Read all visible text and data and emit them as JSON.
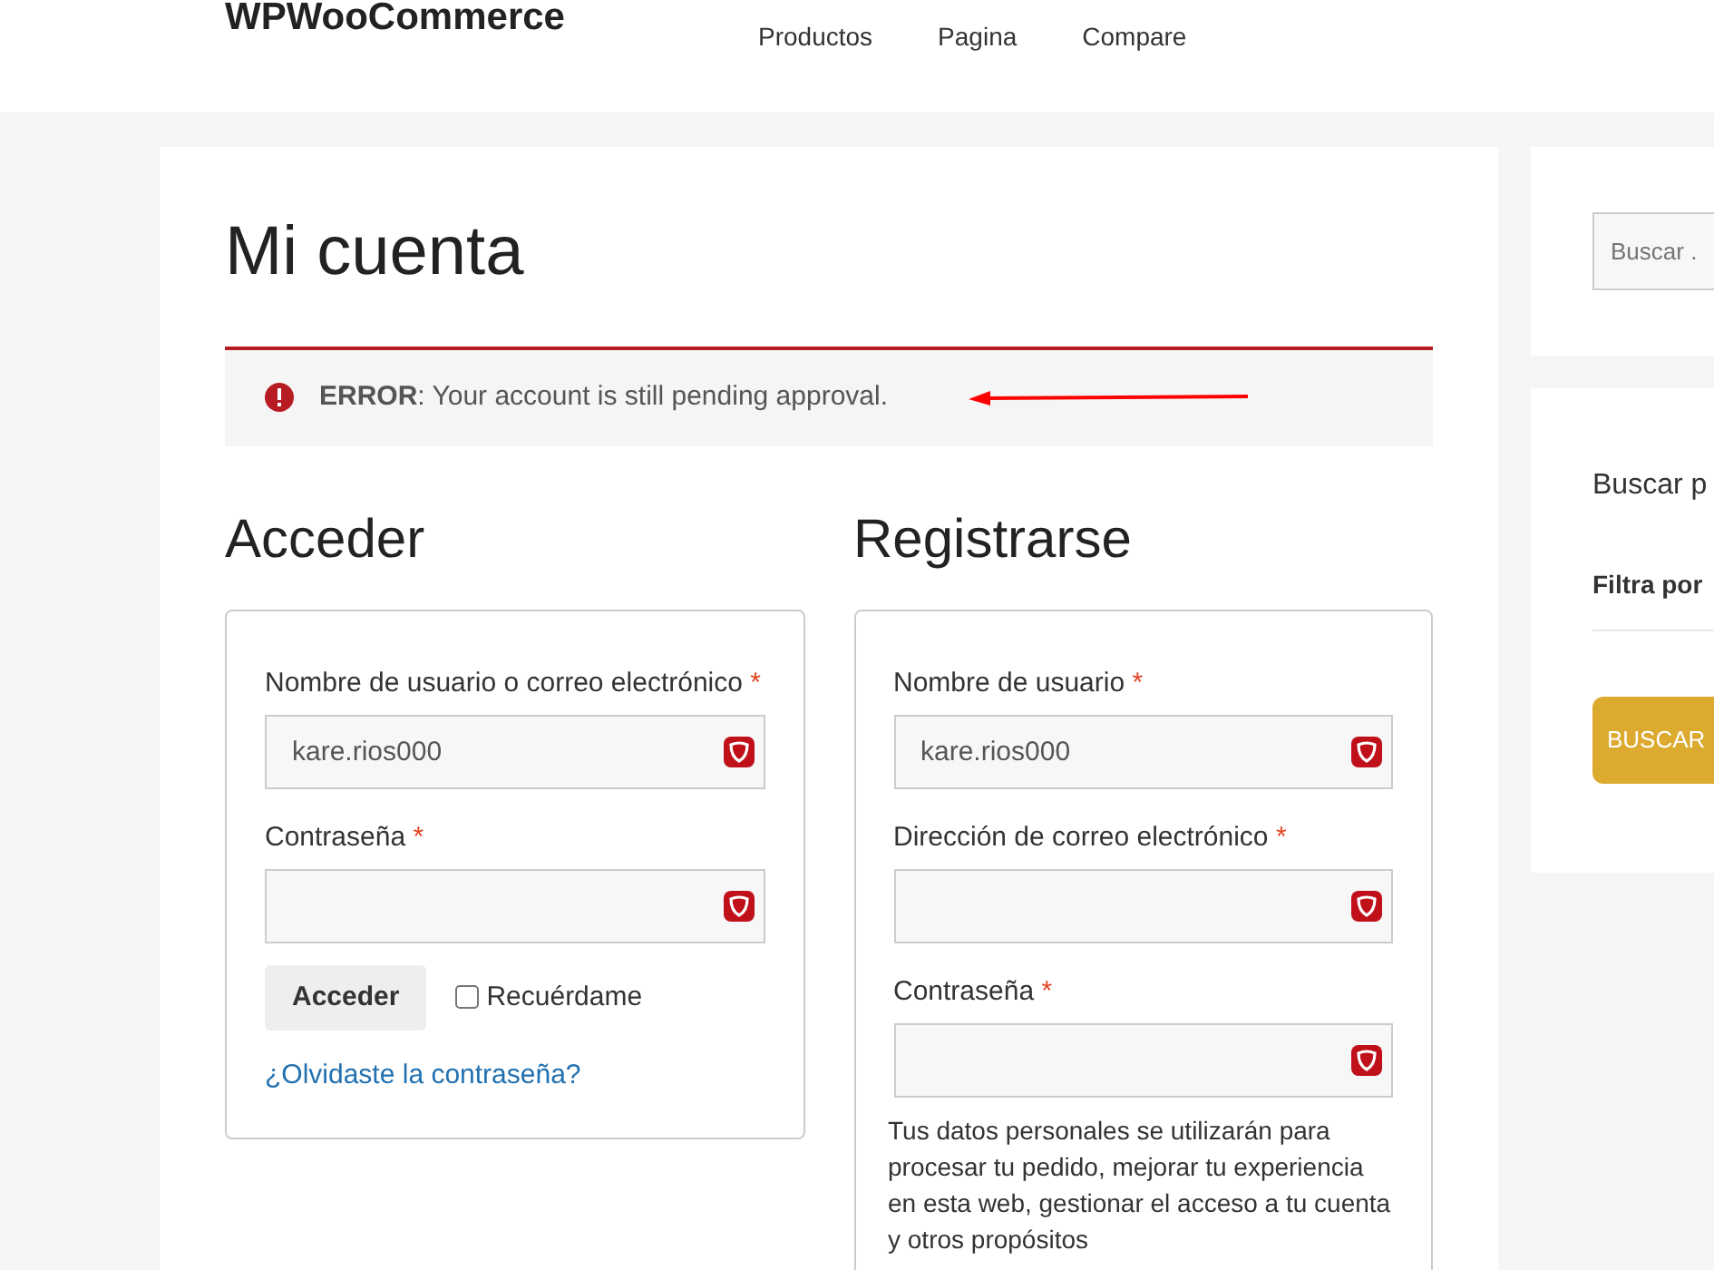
{
  "site_title": "WPWooCommerce",
  "nav": [
    {
      "label": "Productos"
    },
    {
      "label": "Pagina"
    },
    {
      "label": "Compare"
    }
  ],
  "page_title": "Mi cuenta",
  "notice": {
    "label": "ERROR",
    "message": ": Your account is still pending approval."
  },
  "required_mark": "*",
  "login": {
    "title": "Acceder",
    "fields": [
      {
        "label": "Nombre de usuario o correo electrónico",
        "required": true,
        "value": "kare.rios000"
      },
      {
        "label": "Contraseña",
        "required": true
      }
    ],
    "button": "Acceder",
    "remember": {
      "label": "Recuérdame",
      "checked": false
    },
    "lost_password": "¿Olvidaste la contraseña?"
  },
  "register": {
    "title": "Registrarse",
    "fields": [
      {
        "label": "Nombre de usuario",
        "required": true,
        "value": "kare.rios000"
      },
      {
        "label": "Dirección de correo electrónico",
        "required": true
      },
      {
        "label": "Contraseña",
        "required": true
      }
    ],
    "privacy": "Tus datos personales se utilizarán para procesar tu pedido, mejorar tu experiencia en esta web, gestionar el acceso a tu cuenta y otros propósitos"
  },
  "sidebar": {
    "search_placeholder": "Buscar .",
    "heading": "Buscar p",
    "filter_label": "Filtra por",
    "button": "BUSCAR"
  }
}
